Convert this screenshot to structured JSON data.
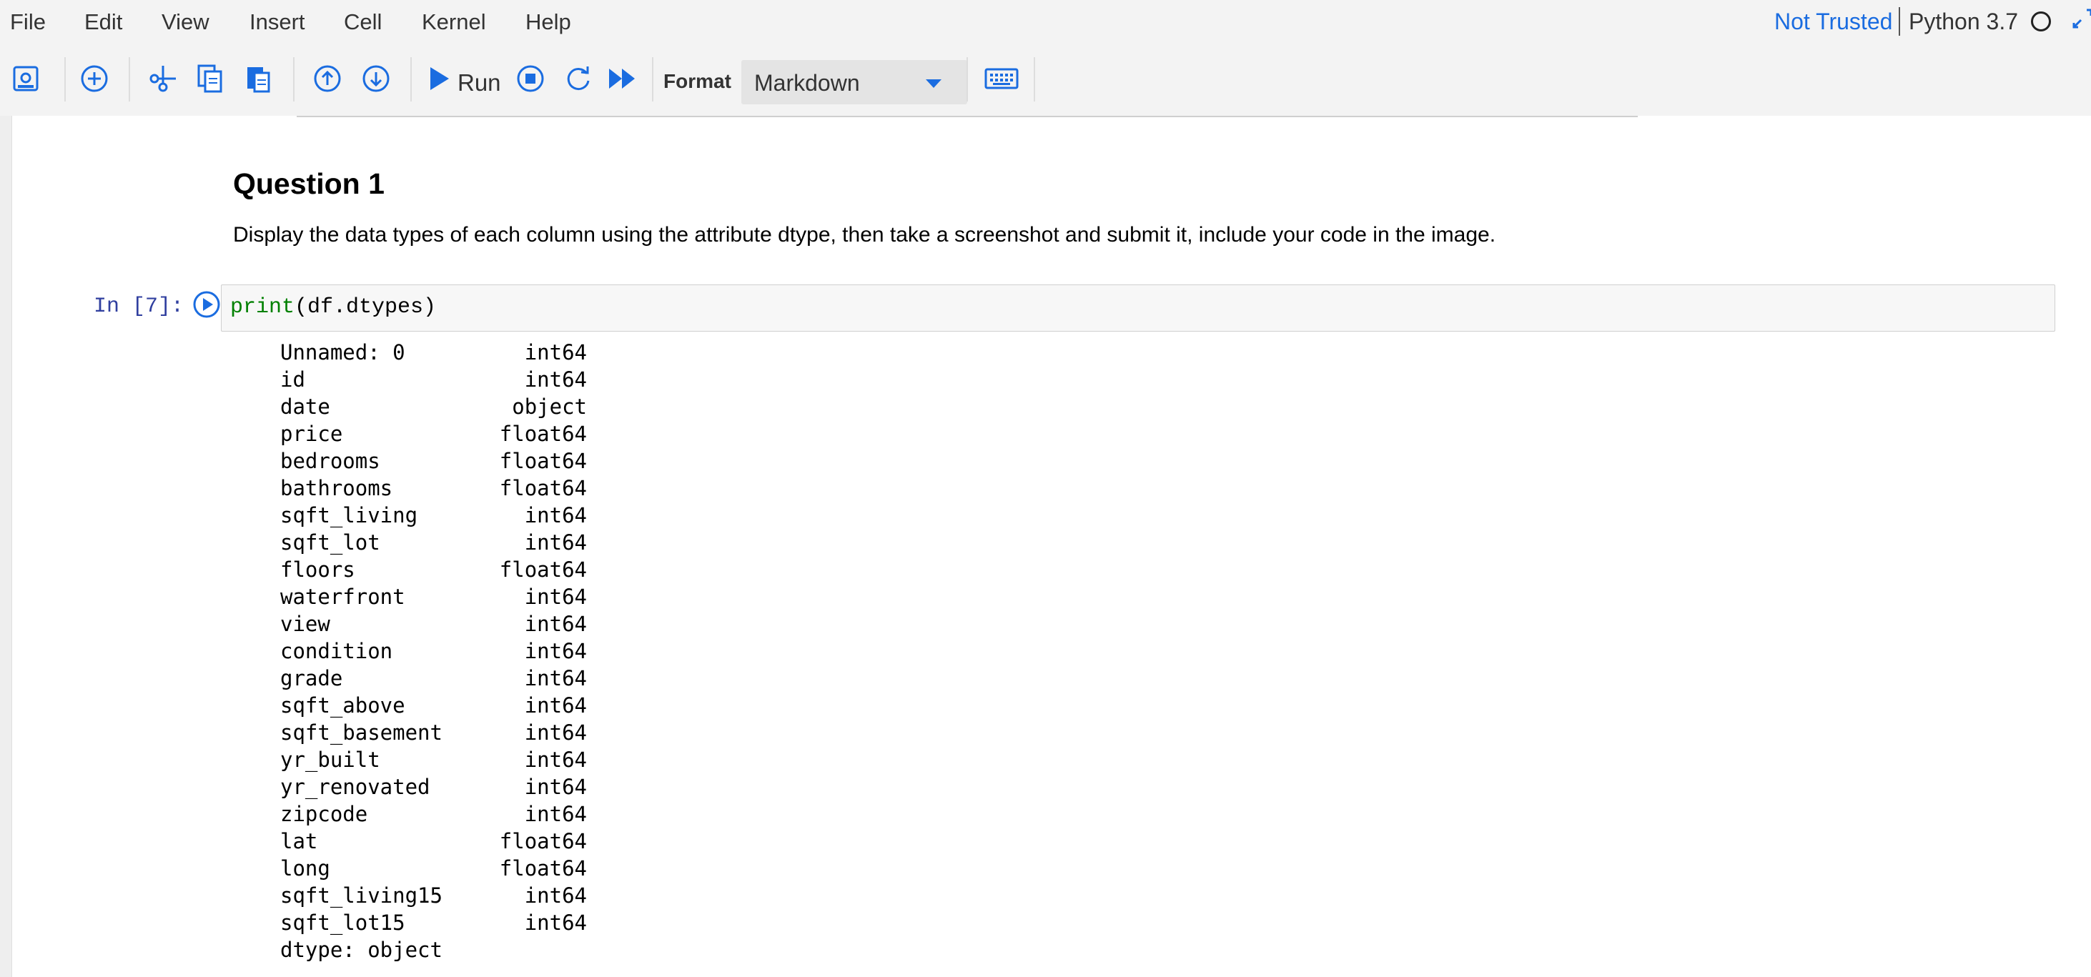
{
  "menu": {
    "items": [
      "File",
      "Edit",
      "View",
      "Insert",
      "Cell",
      "Kernel",
      "Help"
    ]
  },
  "kernel": {
    "trust_status": "Not Trusted",
    "name": "Python 3.7"
  },
  "toolbar": {
    "run_label": "Run",
    "format_label": "Format",
    "format_value": "Markdown",
    "icons": [
      "save-icon",
      "add-cell-icon",
      "cut-icon",
      "copy-icon",
      "paste-icon",
      "move-up-icon",
      "move-down-icon",
      "run-icon",
      "stop-icon",
      "restart-icon",
      "fast-forward-icon",
      "keyboard-icon"
    ],
    "accent_color": "#1a6ce0"
  },
  "markdown": {
    "heading": "Question 1",
    "text": "Display the data types of each column using the attribute dtype, then take a screenshot and submit it, include your code in the image."
  },
  "code_cell": {
    "prompt": "In [7]:",
    "code_builtin": "print",
    "code_rest": "(df.dtypes)"
  },
  "output": {
    "rows": [
      {
        "name": "Unnamed: 0",
        "dtype": "int64"
      },
      {
        "name": "id",
        "dtype": "int64"
      },
      {
        "name": "date",
        "dtype": "object"
      },
      {
        "name": "price",
        "dtype": "float64"
      },
      {
        "name": "bedrooms",
        "dtype": "float64"
      },
      {
        "name": "bathrooms",
        "dtype": "float64"
      },
      {
        "name": "sqft_living",
        "dtype": "int64"
      },
      {
        "name": "sqft_lot",
        "dtype": "int64"
      },
      {
        "name": "floors",
        "dtype": "float64"
      },
      {
        "name": "waterfront",
        "dtype": "int64"
      },
      {
        "name": "view",
        "dtype": "int64"
      },
      {
        "name": "condition",
        "dtype": "int64"
      },
      {
        "name": "grade",
        "dtype": "int64"
      },
      {
        "name": "sqft_above",
        "dtype": "int64"
      },
      {
        "name": "sqft_basement",
        "dtype": "int64"
      },
      {
        "name": "yr_built",
        "dtype": "int64"
      },
      {
        "name": "yr_renovated",
        "dtype": "int64"
      },
      {
        "name": "zipcode",
        "dtype": "int64"
      },
      {
        "name": "lat",
        "dtype": "float64"
      },
      {
        "name": "long",
        "dtype": "float64"
      },
      {
        "name": "sqft_living15",
        "dtype": "int64"
      },
      {
        "name": "sqft_lot15",
        "dtype": "int64"
      }
    ],
    "footer": "dtype: object"
  }
}
